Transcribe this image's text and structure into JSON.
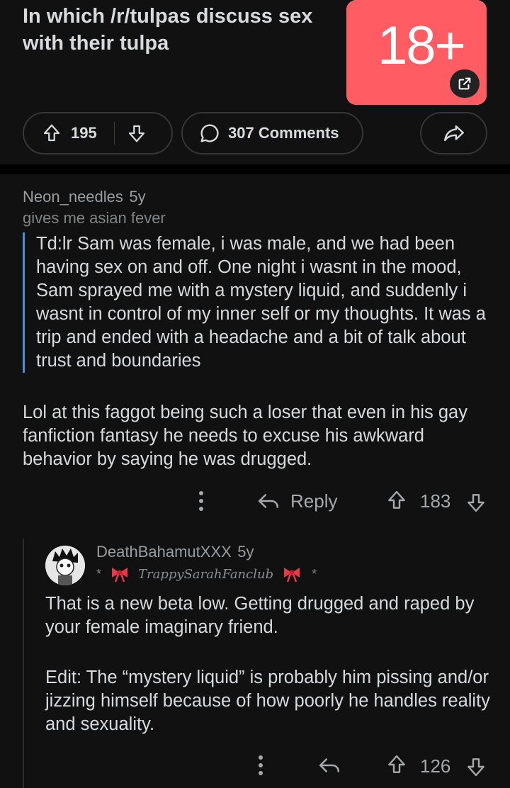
{
  "post": {
    "title": "In which /r/tulpas discuss sex with their tulpa",
    "thumbnail_label": "18+",
    "votes": "195",
    "comments_label": "307 Comments"
  },
  "comment1": {
    "username": "Neon_needles",
    "age": "5y",
    "flair": "gives me asian fever",
    "quote": "Td:lr Sam was female, i was male, and we had been having sex on and off. One night i wasnt in the mood, Sam sprayed me with a mystery liquid, and suddenly i wasnt in control of my inner self or my thoughts. It was a trip and ended with a headache and a bit of talk about trust and boundaries",
    "body": "Lol at this faggot being such a loser that even in his gay fanfiction fantasy he needs to excuse his awkward behavior by saying he was drugged.",
    "reply_label": "Reply",
    "votes": "183"
  },
  "comment2": {
    "username": "DeathBahamutXXX",
    "age": "5y",
    "flair_star_left": "*",
    "flair_text": "TrappySarahFanclub",
    "flair_star_right": "*",
    "body_p1": "That is a new beta low. Getting drugged and raped by your female imaginary friend.",
    "body_p2": "Edit: The “mystery liquid” is probably him pissing and/or jizzing himself because of how poorly he handles reality and sexuality.",
    "votes": "126"
  },
  "colors": {
    "background": "#111111",
    "nsfw_red": "#ff5c64",
    "quote_bar": "#4a90d9",
    "text": "#d7dadc",
    "muted": "#818384"
  }
}
